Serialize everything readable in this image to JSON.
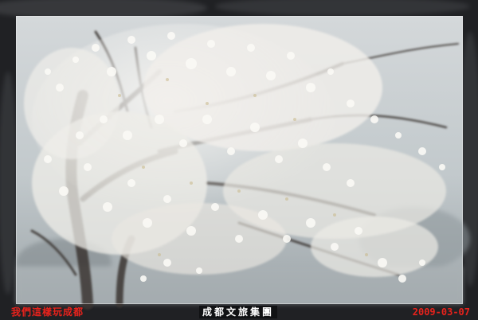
{
  "image": {
    "subject": "Blossoming white cherry tree in mist, framed photo",
    "colors": {
      "frame": "#202124",
      "blossom": "#f4f2ee",
      "branch": "#3b3531",
      "sky": "#c9cfd2",
      "caption_red": "#e8221c",
      "caption_white": "#ffffff"
    }
  },
  "captions": {
    "left": "我們這樣玩成都",
    "center": "成都文旅集團",
    "date": "2009-03-07"
  }
}
